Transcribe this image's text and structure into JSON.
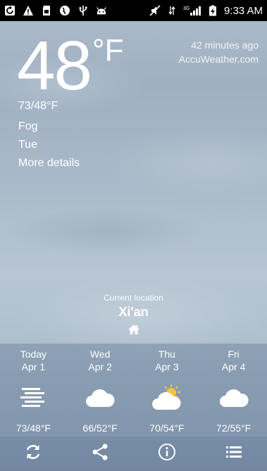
{
  "status_bar": {
    "time": "9:33 AM",
    "network": "3G",
    "left_icons": [
      "refresh-icon",
      "warning-icon",
      "sd-card-icon",
      "globe-icon",
      "usb-icon",
      "android-icon"
    ],
    "right_icons": [
      "mute-icon",
      "data-icon",
      "signal-icon",
      "battery-icon"
    ]
  },
  "current": {
    "temperature": "48",
    "unit": "°F",
    "hilo": "73/48°F",
    "condition": "Fog",
    "day": "Tue",
    "more_details": "More details",
    "updated": "42 minutes ago",
    "source": "AccuWeather.com"
  },
  "location": {
    "label": "Current location",
    "name": "Xi'an"
  },
  "forecast": [
    {
      "day": "Today",
      "date": "Apr 1",
      "icon": "fog-icon",
      "temp": "73/48°F"
    },
    {
      "day": "Wed",
      "date": "Apr 2",
      "icon": "cloudy-icon",
      "temp": "66/52°F"
    },
    {
      "day": "Thu",
      "date": "Apr 3",
      "icon": "partly-sunny-icon",
      "temp": "70/54°F"
    },
    {
      "day": "Fri",
      "date": "Apr 4",
      "icon": "cloudy-icon",
      "temp": "72/55°F"
    }
  ],
  "toolbar": [
    "refresh-icon",
    "share-icon",
    "info-icon",
    "list-icon"
  ],
  "colors": {
    "status_bar_bg": "#000000",
    "panel_bg": "#3c5578",
    "sun": "#f5c342",
    "text": "#ffffff"
  }
}
